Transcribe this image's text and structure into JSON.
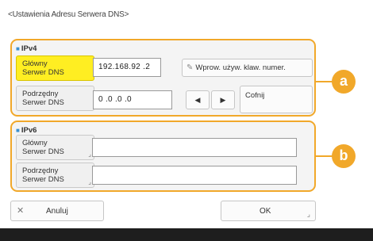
{
  "page_title": "<Ustawienia Adresu Serwera DNS>",
  "ipv4": {
    "caption": "IPv4",
    "primary_label": "Główny Serwer DNS",
    "primary_value": "192.168.92 .2",
    "secondary_label": "Podrzędny Serwer DNS",
    "secondary_value": "0 .0 .0 .0",
    "keyboard_button": "Wprow. używ. klaw. numer.",
    "left_arrow": "◀",
    "right_arrow": "▶",
    "undo_button": "Cofnij"
  },
  "ipv6": {
    "caption": "IPv6",
    "primary_label": "Główny Serwer DNS",
    "primary_value": "",
    "secondary_label": "Podrzędny Serwer DNS",
    "secondary_value": ""
  },
  "markers": {
    "a": "a",
    "b": "b"
  },
  "footer": {
    "cancel_label": "Anuluj",
    "ok_label": "OK"
  },
  "colors": {
    "accent": "#f1a82a",
    "selected": "#ffee22",
    "bar": "#1e1e1e"
  }
}
